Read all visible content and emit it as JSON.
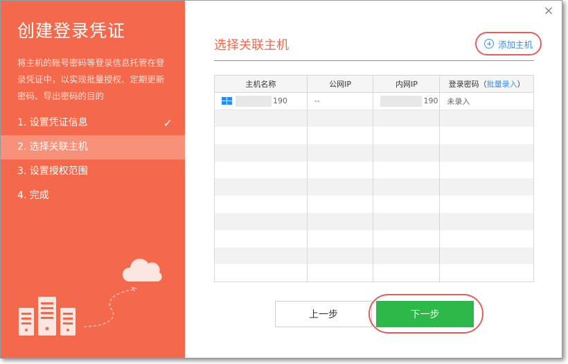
{
  "dialog": {
    "close_glyph": "×"
  },
  "sidebar": {
    "title": "创建登录凭证",
    "description": "将主机的账号密码等登录信息托管在登录凭证中，以实现批量授权、定期更新密码、导出密码的目的",
    "steps": [
      {
        "label": "1. 设置凭证信息",
        "done": true,
        "active": false
      },
      {
        "label": "2. 选择关联主机",
        "done": false,
        "active": true
      },
      {
        "label": "3. 设置授权范围",
        "done": false,
        "active": false
      },
      {
        "label": "4. 完成",
        "done": false,
        "active": false
      }
    ],
    "check_glyph": "✓"
  },
  "main": {
    "title": "选择关联主机",
    "add_host_label": "添加主机",
    "table": {
      "headers": [
        "主机名称",
        "公网IP",
        "内网IP",
        "登录密码"
      ],
      "header_link": "批量录入",
      "header_paren_open": "（",
      "header_paren_close": "）",
      "rows": [
        {
          "name_suffix": "190",
          "public_ip": "--",
          "private_ip_suffix": "190",
          "password": "未录入"
        }
      ]
    }
  },
  "footer": {
    "prev_label": "上一步",
    "next_label": "下一步"
  },
  "colors": {
    "accent": "#f4694b",
    "primary_button": "#2db84a",
    "link": "#3a8ee6",
    "highlight_ring": "#e85b5b"
  }
}
